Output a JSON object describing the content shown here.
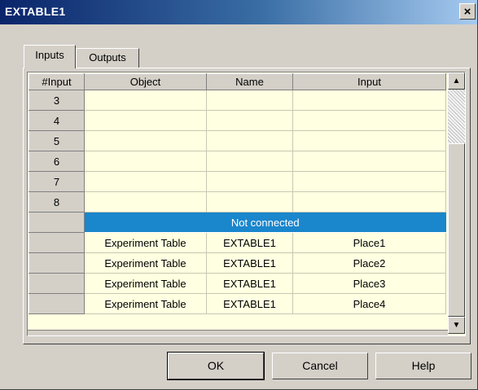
{
  "window": {
    "title": "EXTABLE1",
    "close_glyph": "×"
  },
  "tabs": [
    {
      "label": "Inputs",
      "active": true
    },
    {
      "label": "Outputs",
      "active": false
    }
  ],
  "grid": {
    "columns": [
      "#Input",
      "Object",
      "Name",
      "Input"
    ],
    "numbered_rows": [
      {
        "num": "3",
        "object": "",
        "name": "",
        "input": ""
      },
      {
        "num": "4",
        "object": "",
        "name": "",
        "input": ""
      },
      {
        "num": "5",
        "object": "",
        "name": "",
        "input": ""
      },
      {
        "num": "6",
        "object": "",
        "name": "",
        "input": ""
      },
      {
        "num": "7",
        "object": "",
        "name": "",
        "input": ""
      },
      {
        "num": "8",
        "object": "",
        "name": "",
        "input": ""
      }
    ],
    "banner": "Not connected",
    "connected_rows": [
      {
        "object": "Experiment Table",
        "name": "EXTABLE1",
        "input": "Place1"
      },
      {
        "object": "Experiment Table",
        "name": "EXTABLE1",
        "input": "Place2"
      },
      {
        "object": "Experiment Table",
        "name": "EXTABLE1",
        "input": "Place3"
      },
      {
        "object": "Experiment Table",
        "name": "EXTABLE1",
        "input": "Place4"
      }
    ],
    "scroll_up_glyph": "▲",
    "scroll_down_glyph": "▼"
  },
  "buttons": {
    "ok": "OK",
    "cancel": "Cancel",
    "help": "Help"
  },
  "colors": {
    "titlebar": "#0a246a",
    "grid_background": "#ffffe1",
    "selection_banner": "#1a86cc"
  }
}
